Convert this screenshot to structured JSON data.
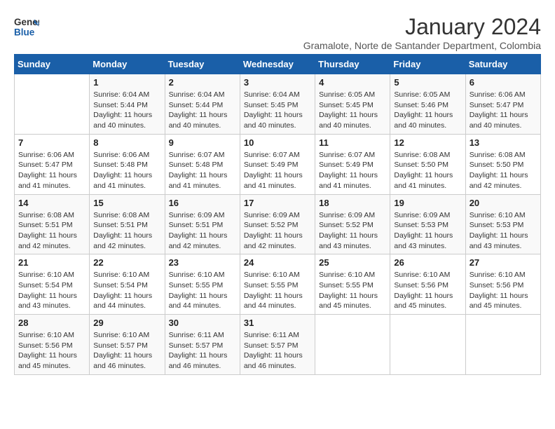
{
  "logo": {
    "line1": "General",
    "line2": "Blue"
  },
  "title": "January 2024",
  "subtitle": "Gramalote, Norte de Santander Department, Colombia",
  "weekdays": [
    "Sunday",
    "Monday",
    "Tuesday",
    "Wednesday",
    "Thursday",
    "Friday",
    "Saturday"
  ],
  "weeks": [
    [
      {
        "num": "",
        "sunrise": "",
        "sunset": "",
        "daylight": ""
      },
      {
        "num": "1",
        "sunrise": "Sunrise: 6:04 AM",
        "sunset": "Sunset: 5:44 PM",
        "daylight": "Daylight: 11 hours and 40 minutes."
      },
      {
        "num": "2",
        "sunrise": "Sunrise: 6:04 AM",
        "sunset": "Sunset: 5:44 PM",
        "daylight": "Daylight: 11 hours and 40 minutes."
      },
      {
        "num": "3",
        "sunrise": "Sunrise: 6:04 AM",
        "sunset": "Sunset: 5:45 PM",
        "daylight": "Daylight: 11 hours and 40 minutes."
      },
      {
        "num": "4",
        "sunrise": "Sunrise: 6:05 AM",
        "sunset": "Sunset: 5:45 PM",
        "daylight": "Daylight: 11 hours and 40 minutes."
      },
      {
        "num": "5",
        "sunrise": "Sunrise: 6:05 AM",
        "sunset": "Sunset: 5:46 PM",
        "daylight": "Daylight: 11 hours and 40 minutes."
      },
      {
        "num": "6",
        "sunrise": "Sunrise: 6:06 AM",
        "sunset": "Sunset: 5:47 PM",
        "daylight": "Daylight: 11 hours and 40 minutes."
      }
    ],
    [
      {
        "num": "7",
        "sunrise": "Sunrise: 6:06 AM",
        "sunset": "Sunset: 5:47 PM",
        "daylight": "Daylight: 11 hours and 41 minutes."
      },
      {
        "num": "8",
        "sunrise": "Sunrise: 6:06 AM",
        "sunset": "Sunset: 5:48 PM",
        "daylight": "Daylight: 11 hours and 41 minutes."
      },
      {
        "num": "9",
        "sunrise": "Sunrise: 6:07 AM",
        "sunset": "Sunset: 5:48 PM",
        "daylight": "Daylight: 11 hours and 41 minutes."
      },
      {
        "num": "10",
        "sunrise": "Sunrise: 6:07 AM",
        "sunset": "Sunset: 5:49 PM",
        "daylight": "Daylight: 11 hours and 41 minutes."
      },
      {
        "num": "11",
        "sunrise": "Sunrise: 6:07 AM",
        "sunset": "Sunset: 5:49 PM",
        "daylight": "Daylight: 11 hours and 41 minutes."
      },
      {
        "num": "12",
        "sunrise": "Sunrise: 6:08 AM",
        "sunset": "Sunset: 5:50 PM",
        "daylight": "Daylight: 11 hours and 41 minutes."
      },
      {
        "num": "13",
        "sunrise": "Sunrise: 6:08 AM",
        "sunset": "Sunset: 5:50 PM",
        "daylight": "Daylight: 11 hours and 42 minutes."
      }
    ],
    [
      {
        "num": "14",
        "sunrise": "Sunrise: 6:08 AM",
        "sunset": "Sunset: 5:51 PM",
        "daylight": "Daylight: 11 hours and 42 minutes."
      },
      {
        "num": "15",
        "sunrise": "Sunrise: 6:08 AM",
        "sunset": "Sunset: 5:51 PM",
        "daylight": "Daylight: 11 hours and 42 minutes."
      },
      {
        "num": "16",
        "sunrise": "Sunrise: 6:09 AM",
        "sunset": "Sunset: 5:51 PM",
        "daylight": "Daylight: 11 hours and 42 minutes."
      },
      {
        "num": "17",
        "sunrise": "Sunrise: 6:09 AM",
        "sunset": "Sunset: 5:52 PM",
        "daylight": "Daylight: 11 hours and 42 minutes."
      },
      {
        "num": "18",
        "sunrise": "Sunrise: 6:09 AM",
        "sunset": "Sunset: 5:52 PM",
        "daylight": "Daylight: 11 hours and 43 minutes."
      },
      {
        "num": "19",
        "sunrise": "Sunrise: 6:09 AM",
        "sunset": "Sunset: 5:53 PM",
        "daylight": "Daylight: 11 hours and 43 minutes."
      },
      {
        "num": "20",
        "sunrise": "Sunrise: 6:10 AM",
        "sunset": "Sunset: 5:53 PM",
        "daylight": "Daylight: 11 hours and 43 minutes."
      }
    ],
    [
      {
        "num": "21",
        "sunrise": "Sunrise: 6:10 AM",
        "sunset": "Sunset: 5:54 PM",
        "daylight": "Daylight: 11 hours and 43 minutes."
      },
      {
        "num": "22",
        "sunrise": "Sunrise: 6:10 AM",
        "sunset": "Sunset: 5:54 PM",
        "daylight": "Daylight: 11 hours and 44 minutes."
      },
      {
        "num": "23",
        "sunrise": "Sunrise: 6:10 AM",
        "sunset": "Sunset: 5:55 PM",
        "daylight": "Daylight: 11 hours and 44 minutes."
      },
      {
        "num": "24",
        "sunrise": "Sunrise: 6:10 AM",
        "sunset": "Sunset: 5:55 PM",
        "daylight": "Daylight: 11 hours and 44 minutes."
      },
      {
        "num": "25",
        "sunrise": "Sunrise: 6:10 AM",
        "sunset": "Sunset: 5:55 PM",
        "daylight": "Daylight: 11 hours and 45 minutes."
      },
      {
        "num": "26",
        "sunrise": "Sunrise: 6:10 AM",
        "sunset": "Sunset: 5:56 PM",
        "daylight": "Daylight: 11 hours and 45 minutes."
      },
      {
        "num": "27",
        "sunrise": "Sunrise: 6:10 AM",
        "sunset": "Sunset: 5:56 PM",
        "daylight": "Daylight: 11 hours and 45 minutes."
      }
    ],
    [
      {
        "num": "28",
        "sunrise": "Sunrise: 6:10 AM",
        "sunset": "Sunset: 5:56 PM",
        "daylight": "Daylight: 11 hours and 45 minutes."
      },
      {
        "num": "29",
        "sunrise": "Sunrise: 6:10 AM",
        "sunset": "Sunset: 5:57 PM",
        "daylight": "Daylight: 11 hours and 46 minutes."
      },
      {
        "num": "30",
        "sunrise": "Sunrise: 6:11 AM",
        "sunset": "Sunset: 5:57 PM",
        "daylight": "Daylight: 11 hours and 46 minutes."
      },
      {
        "num": "31",
        "sunrise": "Sunrise: 6:11 AM",
        "sunset": "Sunset: 5:57 PM",
        "daylight": "Daylight: 11 hours and 46 minutes."
      },
      {
        "num": "",
        "sunrise": "",
        "sunset": "",
        "daylight": ""
      },
      {
        "num": "",
        "sunrise": "",
        "sunset": "",
        "daylight": ""
      },
      {
        "num": "",
        "sunrise": "",
        "sunset": "",
        "daylight": ""
      }
    ]
  ]
}
